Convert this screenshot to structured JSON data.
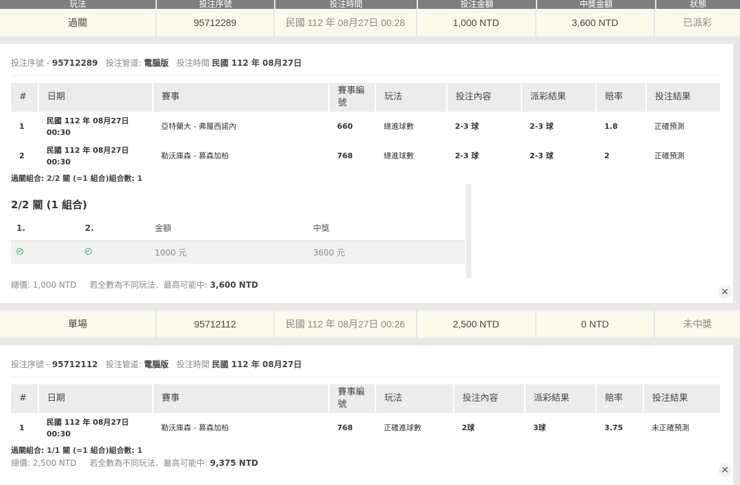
{
  "header": {
    "columns": [
      "玩法",
      "投注序號",
      "投注時間",
      "投注金額",
      "中獎金額",
      "狀態"
    ]
  },
  "bets": [
    {
      "summary": {
        "type": "過關",
        "serial": "95712289",
        "time": "民國 112 年 08月27日 00:28",
        "amount": "1,000 NTD",
        "prize": "3,600 NTD",
        "status": "已派彩"
      },
      "meta": {
        "serial_label": "投注序號 -",
        "serial": "95712289",
        "channel_label": "投注管道:",
        "channel": "電腦版",
        "time_label": "投注時間",
        "time": "民國 112 年 08月27日"
      },
      "columns": [
        "#",
        "日期",
        "賽事",
        "賽事編號",
        "玩法",
        "投注內容",
        "派彩結果",
        "賠率",
        "投注結果"
      ],
      "rows": [
        {
          "no": "1",
          "date": "民國 112 年 08月27日 00:30",
          "match": "亞特蘭大 - 弗羅西諾內",
          "match_no": "660",
          "play": "總進球數",
          "pick": "2-3 球",
          "result": "2-3 球",
          "odds": "1.8",
          "outcome": "正確預測"
        },
        {
          "no": "2",
          "date": "民國 112 年 08月27日 00:30",
          "match": "勒沃庫森 - 慕森加柏",
          "match_no": "768",
          "play": "總進球數",
          "pick": "2-3 球",
          "result": "2-3 球",
          "odds": "2",
          "outcome": "正確預測"
        }
      ],
      "combo": "過關組合: 2/2 關 (=1 組合)組合數: 1",
      "combo_detail": {
        "title": "2/2 關 (1 組合)",
        "columns": [
          "1.",
          "2.",
          "金額",
          "中獎"
        ],
        "row": {
          "amount": "1000 元",
          "prize": "3600 元"
        }
      },
      "total": {
        "label": "總價: 1,000 NTD",
        "note": "若全數為不同玩法．最高可能中:",
        "max": "3,600 NTD"
      }
    },
    {
      "summary": {
        "type": "單場",
        "serial": "95712112",
        "time": "民國 112 年 08月27日 00:26",
        "amount": "2,500 NTD",
        "prize": "0 NTD",
        "status": "未中獎"
      },
      "meta": {
        "serial_label": "投注序號 -",
        "serial": "95712112",
        "channel_label": "投注管道:",
        "channel": "電腦版",
        "time_label": "投注時間",
        "time": "民國 112 年 08月27日"
      },
      "columns": [
        "#",
        "日期",
        "賽事",
        "賽事編號",
        "玩法",
        "投注內容",
        "派彩結果",
        "賠率",
        "投注結果"
      ],
      "rows": [
        {
          "no": "1",
          "date": "民國 112 年 08月27日 00:30",
          "match": "勒沃庫森 - 慕森加柏",
          "match_no": "768",
          "play": "正確進球數",
          "pick": "2球",
          "result": "3球",
          "odds": "3.75",
          "outcome": "未正確預測"
        }
      ],
      "combo": "過關組合: 1/1 關 (=1 組合)組合數: 1",
      "total": {
        "label": "總價: 2,500 NTD",
        "note": "若全數為不同玩法．最高可能中:",
        "max": "9,375 NTD"
      }
    }
  ],
  "close_glyph": "×",
  "icons": {
    "check": "check-circle-icon",
    "close": "close-icon"
  },
  "colors": {
    "summary_bg": "#fbf9ea",
    "header_bg": "#7f7f7f",
    "success": "#3cb371"
  }
}
